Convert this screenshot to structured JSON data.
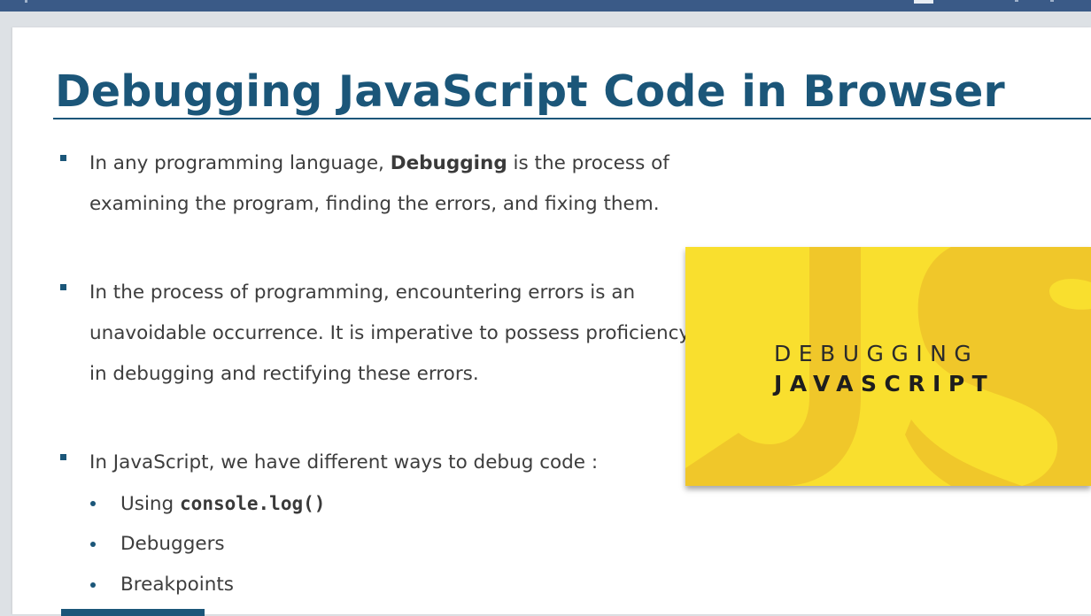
{
  "slide": {
    "title": "Debugging JavaScript Code in Browser",
    "bullets": [
      {
        "line1_pre": "In any programming language, ",
        "line1_bold": "Debugging",
        "line1_post": " is the process of",
        "line2": "examining the program, finding the errors, and fixing them."
      },
      {
        "line1": "In the process of programming, encountering errors is an",
        "line2": "unavoidable occurrence. It is imperative to possess proficiency",
        "line3": "in debugging and rectifying these errors."
      },
      {
        "line1": "In JavaScript, we have different ways to debug code :"
      }
    ],
    "sub_items": [
      {
        "pre": "Using ",
        "code": "console.log()"
      },
      {
        "text": "Debuggers"
      },
      {
        "text": "Breakpoints"
      }
    ],
    "promo": {
      "line1": "DEBUGGING",
      "line2": "JAVASCRIPT",
      "watermark": "JS"
    }
  },
  "colors": {
    "accent": "#1b5679",
    "promo_yellow": "#f9df2e",
    "promo_shape": "#f0c72a",
    "topbar": "#3a5a87"
  }
}
